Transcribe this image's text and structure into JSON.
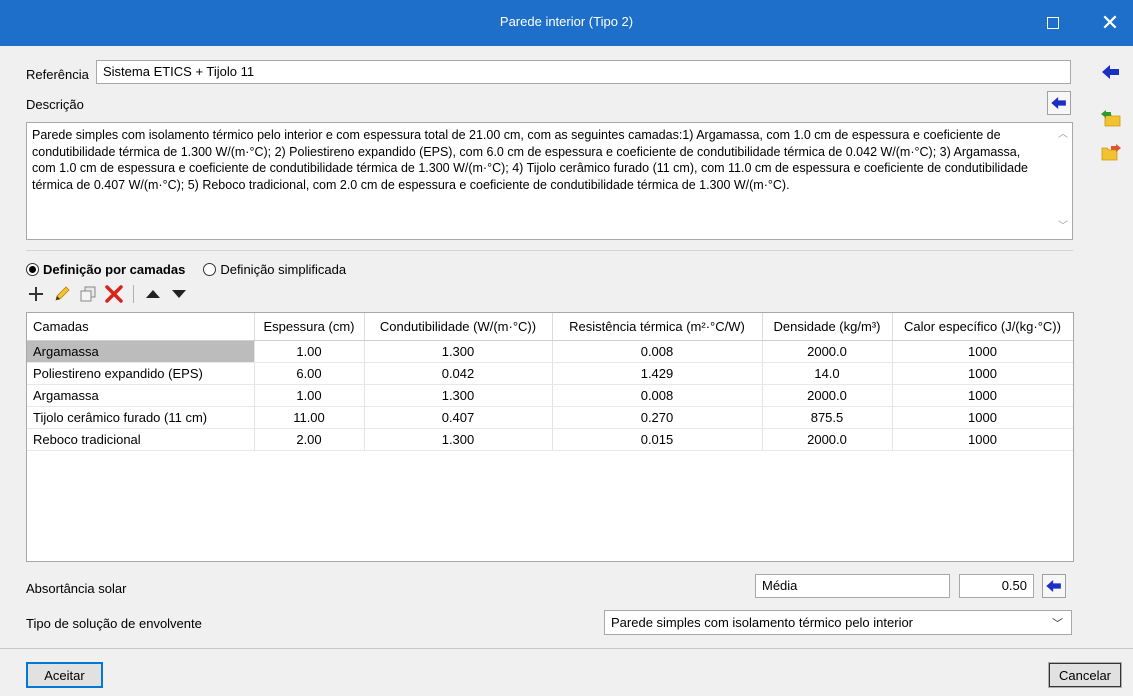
{
  "window": {
    "title": "Parede interior (Tipo 2)",
    "maximize_icon": "maximize-icon",
    "close_glyph": "✕"
  },
  "referencia": {
    "label": "Referência",
    "value": "Sistema ETICS + Tijolo 11"
  },
  "descricao": {
    "label": "Descrição",
    "text": "Parede simples com isolamento térmico pelo interior e com espessura total de 21.00 cm, com as seguintes camadas:1) Argamassa, com 1.0 cm de espessura e coeficiente de condutibilidade térmica de 1.300 W/(m·°C); 2) Poliestireno expandido (EPS), com 6.0 cm de espessura e coeficiente de condutibilidade térmica de 0.042 W/(m·°C); 3) Argamassa, com 1.0 cm de espessura e coeficiente de condutibilidade térmica de 1.300 W/(m·°C); 4) Tijolo cerâmico furado (11 cm), com 11.0 cm de espessura e coeficiente de condutibilidade térmica de 0.407 W/(m·°C); 5) Reboco tradicional, com 2.0 cm de espessura e coeficiente de condutibilidade térmica de 1.300 W/(m·°C)."
  },
  "definition": {
    "option_camadas": "Definição por camadas",
    "option_simplificada": "Definição simplificada",
    "selected": "camadas"
  },
  "toolbar_icons": [
    "add-icon",
    "edit-icon",
    "copy-icon",
    "delete-icon",
    "move-up-icon",
    "move-down-icon"
  ],
  "table": {
    "columns": [
      "Camadas",
      "Espessura (cm)",
      "Condutibilidade (W/(m·°C))",
      "Resistência térmica (m²·°C/W)",
      "Densidade (kg/m³)",
      "Calor específico (J/(kg·°C))"
    ],
    "rows": [
      [
        "Argamassa",
        "1.00",
        "1.300",
        "0.008",
        "2000.0",
        "1000"
      ],
      [
        "Poliestireno expandido (EPS)",
        "6.00",
        "0.042",
        "1.429",
        "14.0",
        "1000"
      ],
      [
        "Argamassa",
        "1.00",
        "1.300",
        "0.008",
        "2000.0",
        "1000"
      ],
      [
        "Tijolo cerâmico furado (11 cm)",
        "11.00",
        "0.407",
        "0.270",
        "875.5",
        "1000"
      ],
      [
        "Reboco tradicional",
        "2.00",
        "1.300",
        "0.015",
        "2000.0",
        "1000"
      ]
    ],
    "selected_row": 0
  },
  "absortancia": {
    "label": "Absortância solar",
    "class_value": "Média",
    "numeric_value": "0.50"
  },
  "tipo_solucao": {
    "label": "Tipo de solução de envolvente",
    "value": "Parede simples com isolamento térmico pelo interior"
  },
  "buttons": {
    "accept": "Aceitar",
    "cancel": "Cancelar"
  },
  "colors": {
    "titlebar": "#1e6fc9",
    "arrow_blue": "#1a2fc4",
    "import_green": "#2f9a2f",
    "export_orange": "#e0572b",
    "folder_yellow": "#f2c230",
    "delete_red": "#d9241c"
  }
}
